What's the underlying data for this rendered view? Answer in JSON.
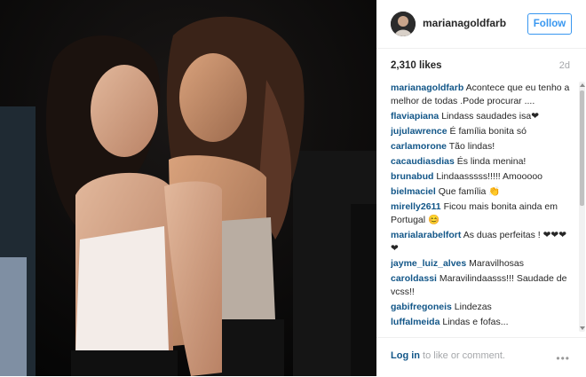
{
  "post": {
    "username": "marianagoldfarb",
    "follow_label": "Follow",
    "likes": "2,310 likes",
    "age": "2d"
  },
  "comments": [
    {
      "user": "marianagoldfarb",
      "text": "Acontece que eu tenho a melhor de todas .Pode procurar ...."
    },
    {
      "user": "flaviapiana",
      "text": "Lindass saudades isa❤"
    },
    {
      "user": "jujulawrence",
      "text": "É família bonita só"
    },
    {
      "user": "carlamorone",
      "text": "Tão lindas!"
    },
    {
      "user": "cacaudiasdias",
      "text": "És linda menina!"
    },
    {
      "user": "brunabud",
      "text": "Lindaasssss!!!!! Amooooo"
    },
    {
      "user": "bielmaciel",
      "text": "Que família 👏"
    },
    {
      "user": "mirelly2611",
      "text": "Ficou mais bonita ainda em Portugal 😊"
    },
    {
      "user": "marialarabelfort",
      "text": "As duas perfeitas ! ❤❤❤❤"
    },
    {
      "user": "jayme_luiz_alves",
      "text": "Maravilhosas"
    },
    {
      "user": "caroldassi",
      "text": "Maravilindaasss!!! Saudade de vcss!!"
    },
    {
      "user": "gabifregoneis",
      "text": "Lindezas"
    },
    {
      "user": "luffalmeida",
      "text": "Lindas e fofas..."
    }
  ],
  "footer": {
    "login_label": "Log in",
    "login_rest": " to like or comment.",
    "more_label": "•••"
  },
  "icons": {
    "more": "more-options-icon"
  },
  "colors": {
    "accent": "#3897f0",
    "username": "#125688",
    "muted": "#a5a7aa"
  }
}
